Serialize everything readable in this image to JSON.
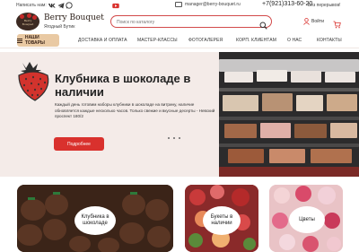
{
  "topbar": {
    "write_label": "Написать нам:",
    "email": "manager@berry-bouquet.ru",
    "phone": "+7(921)313-60-20",
    "work_hours": "Без перерывов!",
    "socials": [
      "vk-icon",
      "telegram-icon",
      "whatsapp-icon",
      "youtube-icon"
    ]
  },
  "header": {
    "brand_name": "Berry Bouquet",
    "brand_tagline": "Ягодный Бутик",
    "logo_text": "Berry Bouquet",
    "search_placeholder": "Поиск по каталогу",
    "login_label": "Войти"
  },
  "nav": {
    "goods_label": "НАШИ ТОВАРЫ",
    "items": [
      "ДОСТАВКА И ОПЛАТА",
      "МАСТЕР-КЛАССЫ",
      "ФОТОГАЛЕРЕЯ",
      "КОРП. КЛИЕНТАМ",
      "О НАС",
      "КОНТАКТЫ"
    ]
  },
  "hero": {
    "title": "Клубника в шоколаде в наличии",
    "text": "Каждый день готовим наборы клубники в шоколаде на витрину, наличие обновляется каждые несколько часов. Только свежие и вкусные десерты - Невский проспект 180/2",
    "button_label": "Подробнее",
    "slides_count": 3
  },
  "cards": [
    {
      "label": "Клубника в шоколаде"
    },
    {
      "label": "Букеты в наличии"
    },
    {
      "label": "Цветы"
    }
  ],
  "colors": {
    "accent": "#d9312d",
    "nav_highlight": "#e9c9a3",
    "hero_bg": "#f4ebe8"
  }
}
